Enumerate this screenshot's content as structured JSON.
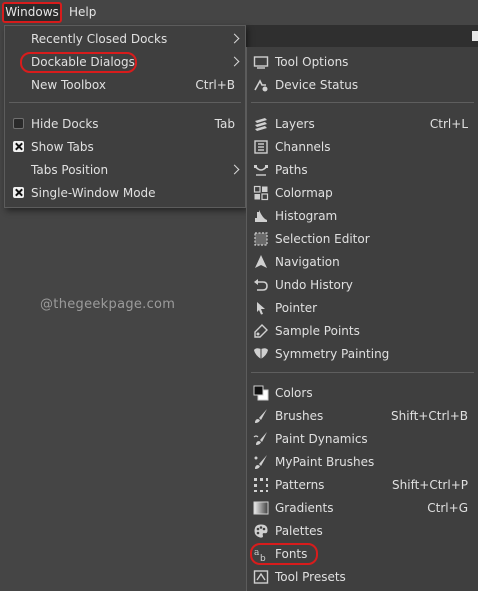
{
  "menubar": {
    "windows": "Windows",
    "help": "Help"
  },
  "windows_menu": {
    "recently_closed_docks": "Recently Closed Docks",
    "dockable_dialogs": "Dockable Dialogs",
    "new_toolbox": "New Toolbox",
    "new_toolbox_shortcut": "Ctrl+B",
    "hide_docks": "Hide Docks",
    "hide_docks_shortcut": "Tab",
    "show_tabs": "Show Tabs",
    "tabs_position": "Tabs Position",
    "single_window_mode": "Single-Window Mode",
    "hide_docks_checked": false,
    "show_tabs_checked": true,
    "single_window_mode_checked": true
  },
  "dockable_menu": {
    "tool_options": "Tool Options",
    "device_status": "Device Status",
    "layers": "Layers",
    "layers_shortcut": "Ctrl+L",
    "channels": "Channels",
    "paths": "Paths",
    "colormap": "Colormap",
    "histogram": "Histogram",
    "selection_editor": "Selection Editor",
    "navigation": "Navigation",
    "undo_history": "Undo History",
    "pointer": "Pointer",
    "sample_points": "Sample Points",
    "symmetry_painting": "Symmetry Painting",
    "colors": "Colors",
    "brushes": "Brushes",
    "brushes_shortcut": "Shift+Ctrl+B",
    "paint_dynamics": "Paint Dynamics",
    "mypaint_brushes": "MyPaint Brushes",
    "patterns": "Patterns",
    "patterns_shortcut": "Shift+Ctrl+P",
    "gradients": "Gradients",
    "gradients_shortcut": "Ctrl+G",
    "palettes": "Palettes",
    "fonts": "Fonts",
    "tool_presets": "Tool Presets"
  },
  "watermark": "@thegeekpage.com",
  "colors": {
    "highlight_outline": "#d81c1c",
    "menu_bg": "#3f3f3f",
    "page_bg": "#454545"
  }
}
